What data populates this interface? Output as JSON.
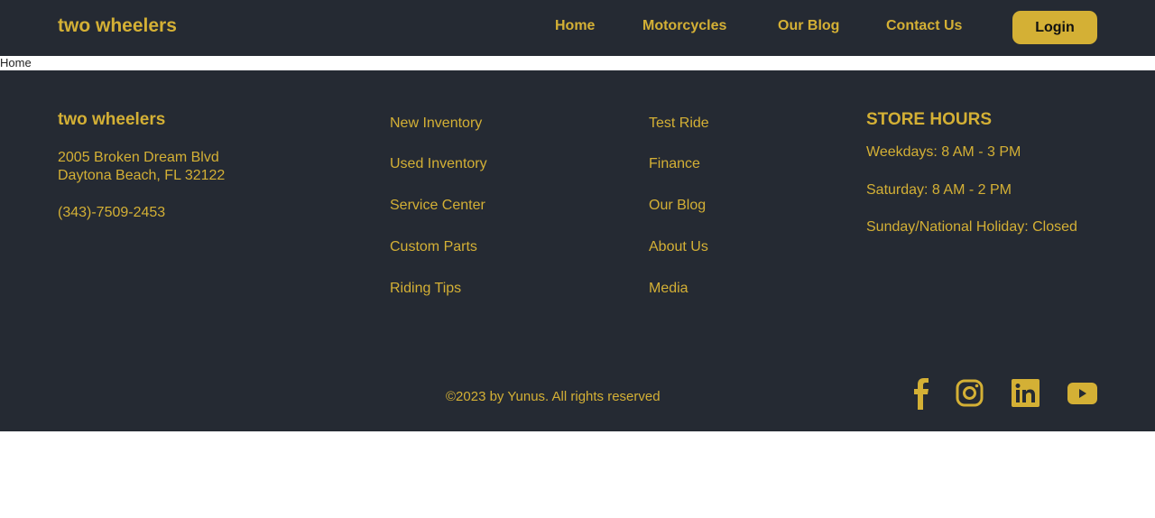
{
  "header": {
    "brand": "two wheelers",
    "nav": [
      "Home",
      "Motorcycles",
      "Our Blog",
      "Contact Us"
    ],
    "login": "Login"
  },
  "breadcrumb": "Home",
  "footer": {
    "brand": "two wheelers",
    "address1": "2005 Broken Dream Blvd",
    "address2": "Daytona Beach, FL 32122",
    "phone": "(343)-7509-2453",
    "col1": [
      "New Inventory",
      "Used Inventory",
      "Service Center",
      "Custom Parts",
      "Riding Tips"
    ],
    "col2": [
      "Test Ride",
      "Finance",
      "Our Blog",
      "About Us",
      "Media"
    ],
    "hours_title": "STORE HOURS",
    "hours": [
      "Weekdays: 8 AM - 3 PM",
      "Saturday: 8 AM - 2 PM",
      "Sunday/National Holiday: Closed"
    ],
    "copyright": "©2023 by Yunus. All rights reserved",
    "social": [
      "facebook-icon",
      "instagram-icon",
      "linkedin-icon",
      "youtube-icon"
    ]
  },
  "colors": {
    "accent": "#d4b035",
    "background": "#252a33"
  }
}
